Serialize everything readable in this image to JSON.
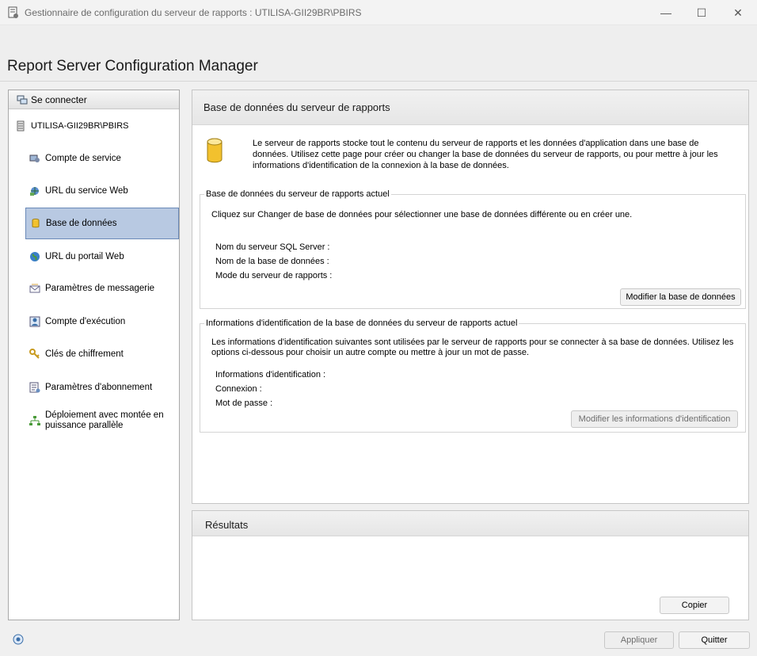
{
  "window": {
    "title": "Gestionnaire de configuration du serveur de rapports : UTILISA-GII29BR\\PBIRS",
    "minimize_glyph": "—",
    "maximize_glyph": "☐",
    "close_glyph": "✕"
  },
  "app_title": "Report Server Configuration Manager",
  "sidebar": {
    "connect_label": "Se connecter",
    "server_name": "UTILISA-GII29BR\\PBIRS",
    "items": [
      {
        "label": "Compte de service",
        "icon": "service-account-icon"
      },
      {
        "label": "URL du service Web",
        "icon": "web-service-url-icon"
      },
      {
        "label": "Base de données",
        "icon": "database-icon",
        "active": true
      },
      {
        "label": "URL du portail Web",
        "icon": "globe-icon"
      },
      {
        "label": "Paramètres de messagerie",
        "icon": "email-icon"
      },
      {
        "label": "Compte d'exécution",
        "icon": "execution-account-icon"
      },
      {
        "label": "Clés de chiffrement",
        "icon": "keys-icon"
      },
      {
        "label": "Paramètres d'abonnement",
        "icon": "subscription-icon"
      },
      {
        "label": "Déploiement avec montée en puissance parallèle",
        "icon": "scale-out-icon"
      }
    ]
  },
  "main": {
    "title": "Base de données du serveur de rapports",
    "intro": "Le serveur de rapports stocke tout le contenu du serveur de rapports et les données d'application dans une base de données. Utilisez cette page pour créer ou changer la base de données du serveur de rapports, ou pour mettre à jour les informations d'identification de la connexion à la base de données.",
    "current_db": {
      "legend": "Base de données du serveur de rapports actuel",
      "instruction": "Cliquez sur Changer de base de données pour sélectionner une base de données différente ou en créer une.",
      "sql_server_label": "Nom du serveur SQL Server :",
      "db_name_label": "Nom de la base de données :",
      "mode_label": "Mode du serveur de rapports :",
      "button": "Modifier la base de données"
    },
    "credentials": {
      "legend": "Informations d'identification de la base de données du serveur de rapports actuel",
      "instruction": "Les informations d'identification suivantes sont utilisées par le serveur de rapports pour se connecter à sa base de données. Utilisez les options ci-dessous pour choisir un autre compte ou mettre à jour un mot de passe.",
      "cred_label": "Informations d'identification :",
      "login_label": "Connexion :",
      "password_label": "Mot de passe :",
      "button": "Modifier les informations d'identification"
    }
  },
  "results": {
    "title": "Résultats",
    "copy_button": "Copier"
  },
  "footer": {
    "apply_button": "Appliquer",
    "quit_button": "Quitter"
  },
  "colors": {
    "active_item_bg": "#b8c9e2",
    "active_item_border": "#6a89b8",
    "db_icon": "#f2c12e"
  }
}
